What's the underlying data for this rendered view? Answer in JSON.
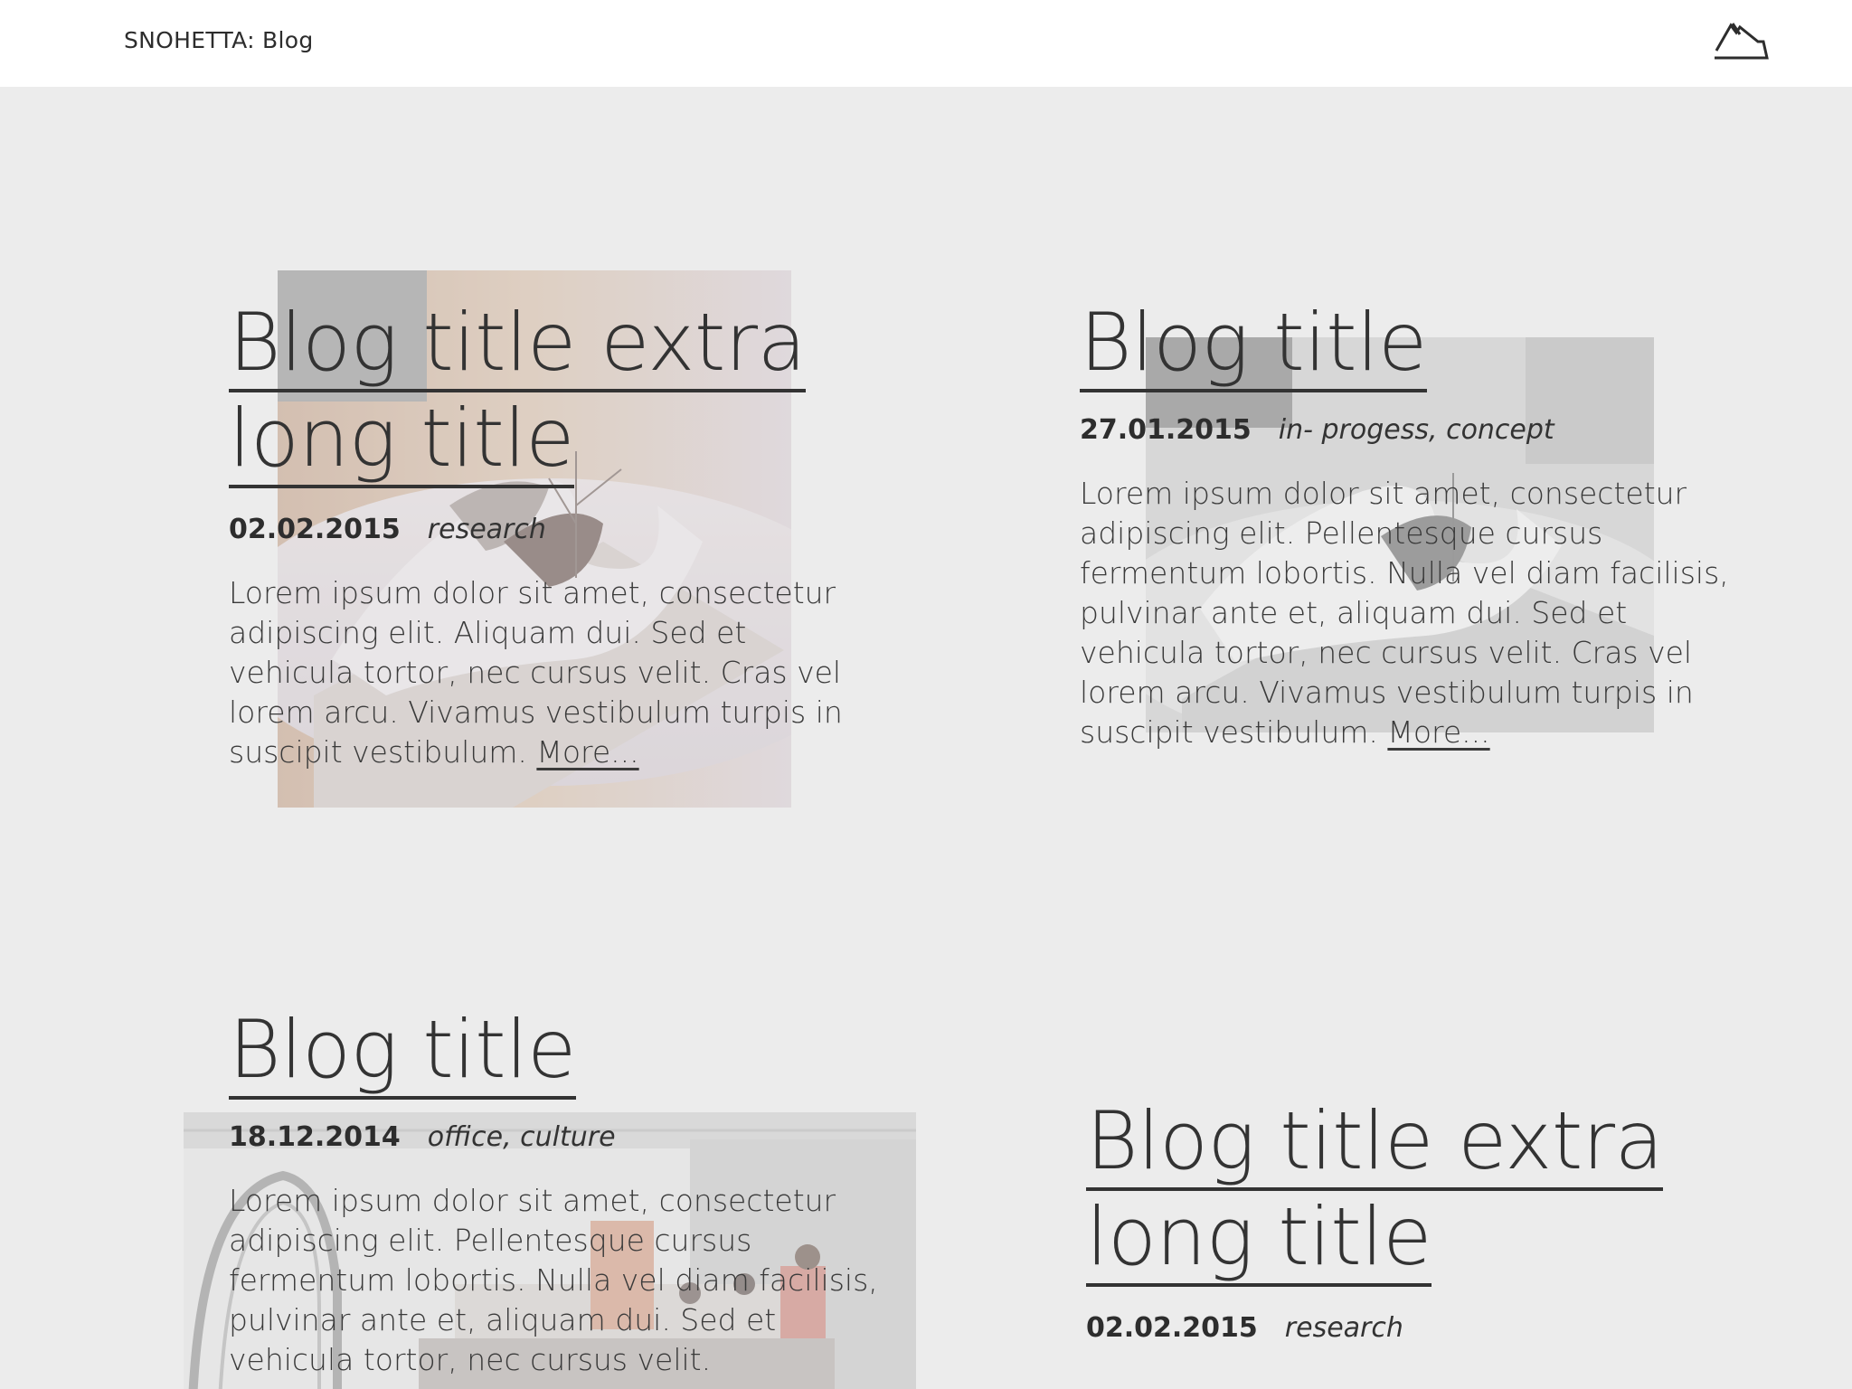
{
  "header": {
    "site_title": "SNOHETTA: Blog"
  },
  "posts": [
    {
      "title_lines": [
        "Blog title extra",
        "long title"
      ],
      "date": "02.02.2015",
      "tags": "research",
      "excerpt": "Lorem ipsum dolor sit amet, consectetur adipiscing elit. Aliquam dui. Sed et vehicula tortor, nec cursus velit. Cras vel lorem arcu. Vivamus vestibulum turpis in suscipit vestibulum.",
      "more": "More..."
    },
    {
      "title_lines": [
        "Blog title"
      ],
      "date": "27.01.2015",
      "tags": "in- progess, concept",
      "excerpt": "Lorem ipsum dolor sit amet, consectetur adipiscing elit. Pellentesque cursus fermentum lobortis. Nulla vel diam facilisis, pulvinar ante et, aliquam dui. Sed et vehicula tortor, nec cursus velit. Cras vel lorem arcu. Vivamus vestibulum turpis in suscipit vestibulum.",
      "more": "More..."
    },
    {
      "title_lines": [
        "Blog title"
      ],
      "date": "18.12.2014",
      "tags": "office, culture",
      "excerpt": "Lorem ipsum dolor sit amet, consectetur adipiscing elit. Pellentesque cursus fermentum lobortis. Nulla vel diam facilisis, pulvinar ante et, aliquam dui. Sed et vehicula tortor, nec cursus velit."
    },
    {
      "title_lines": [
        "Blog title extra",
        "long title"
      ],
      "date": "02.02.2015",
      "tags": "research"
    }
  ],
  "colors": {
    "page_background": "#ececec",
    "header_background": "#ffffff",
    "text": "#333333"
  },
  "icons": {
    "logo": "mountain-logo-icon"
  }
}
